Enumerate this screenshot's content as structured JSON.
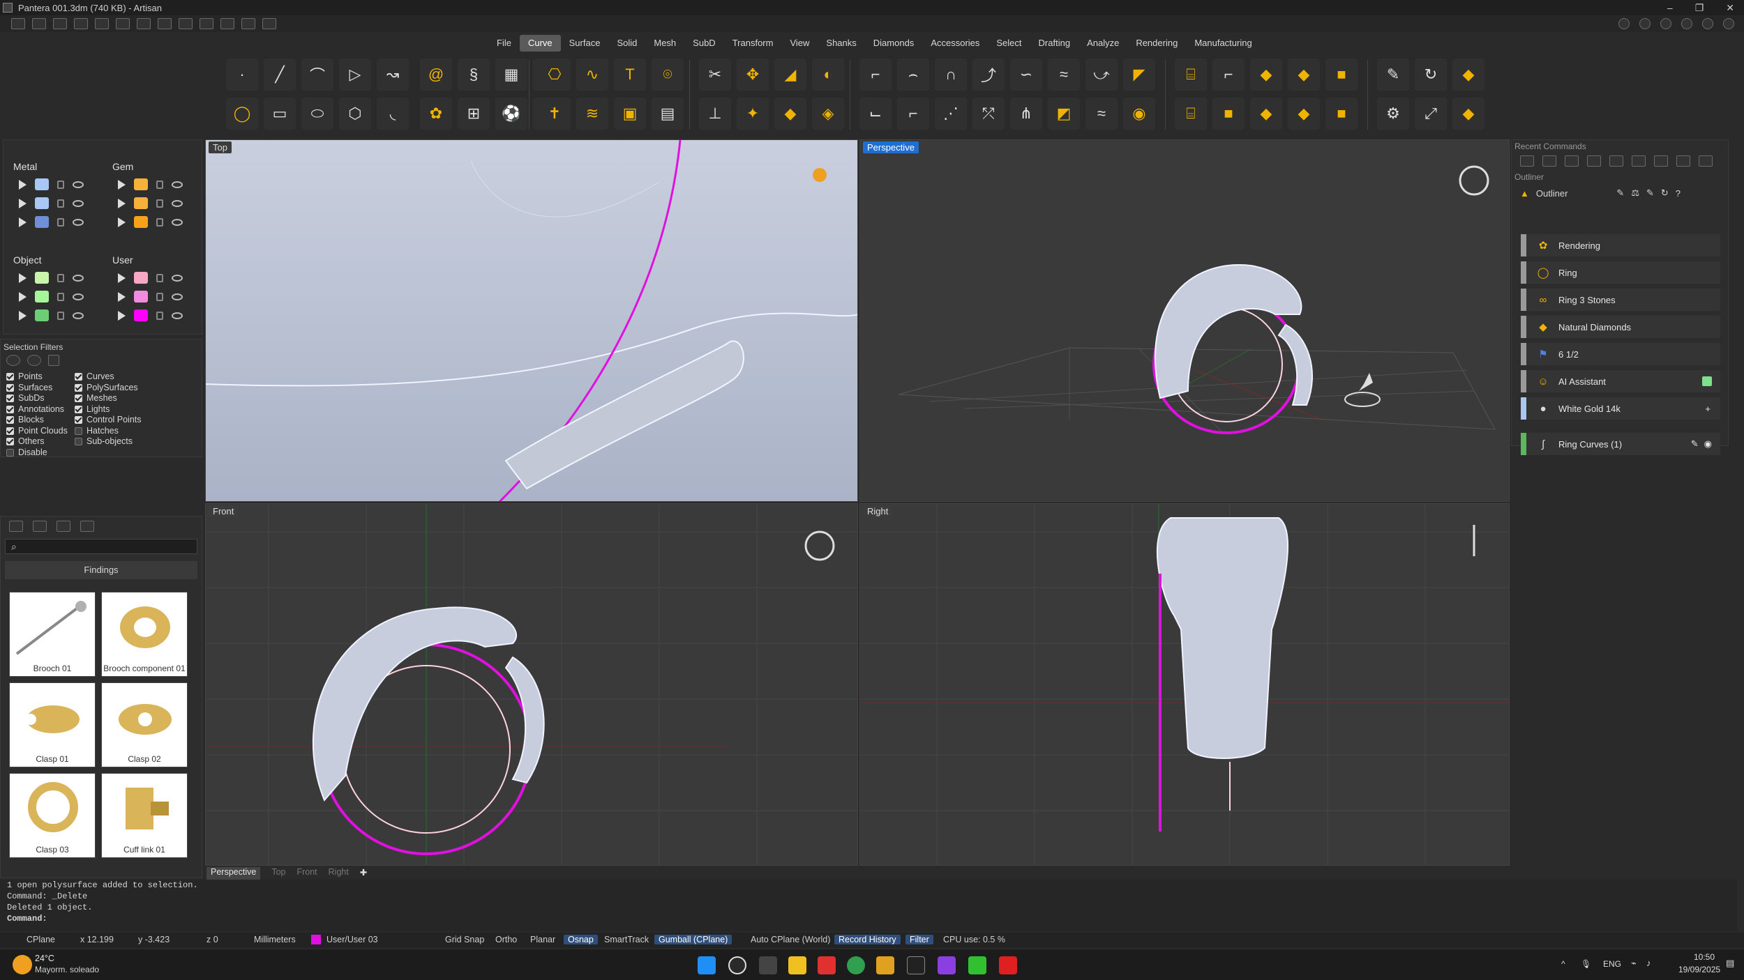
{
  "window": {
    "title": "Pantera 001.3dm (740 KB) - Artisan",
    "buttons": [
      "–",
      "❐",
      "✕"
    ]
  },
  "menu_tabs": [
    "File",
    "Curve",
    "Surface",
    "Solid",
    "Mesh",
    "SubD",
    "Transform",
    "View",
    "Shanks",
    "Diamonds",
    "Accessories",
    "Select",
    "Drafting",
    "Analyze",
    "Rendering",
    "Manufacturing"
  ],
  "active_menu_tab": "Curve",
  "layers": {
    "metal": {
      "title": "Metal",
      "colors": [
        "#a9c7f5",
        "#a9c7f5",
        "#6f8fd8"
      ]
    },
    "gem": {
      "title": "Gem",
      "colors": [
        "#f6b13b",
        "#f6b13b",
        "#f6a21b"
      ]
    },
    "object": {
      "title": "Object",
      "colors": [
        "#c8f5a9",
        "#a6f59a",
        "#6ccf74"
      ]
    },
    "user": {
      "title": "User",
      "colors": [
        "#f7a7c4",
        "#f08be0",
        "#ff00ff"
      ]
    }
  },
  "selection_filters": {
    "title": "Selection Filters",
    "col1": [
      {
        "label": "Points",
        "checked": true
      },
      {
        "label": "Surfaces",
        "checked": true
      },
      {
        "label": "SubDs",
        "checked": true
      },
      {
        "label": "Annotations",
        "checked": true
      },
      {
        "label": "Blocks",
        "checked": true
      },
      {
        "label": "Point Clouds",
        "checked": true
      },
      {
        "label": "Others",
        "checked": true
      },
      {
        "label": "Disable",
        "checked": false
      }
    ],
    "col2": [
      {
        "label": "Curves",
        "checked": true
      },
      {
        "label": "PolySurfaces",
        "checked": true
      },
      {
        "label": "Meshes",
        "checked": true
      },
      {
        "label": "Lights",
        "checked": true
      },
      {
        "label": "Control Points",
        "checked": true
      },
      {
        "label": "Hatches",
        "checked": false
      },
      {
        "label": "Sub-objects",
        "checked": false
      }
    ]
  },
  "findings": {
    "section_title": "Findings",
    "items": [
      "Brooch 01",
      "Brooch component 01",
      "Clasp 01",
      "Clasp 02",
      "Clasp 03",
      "Cuff link 01"
    ]
  },
  "viewports": {
    "top": "Top",
    "perspective": "Perspective",
    "front": "Front",
    "right": "Right"
  },
  "viewport_tabs": [
    "Perspective",
    "Top",
    "Front",
    "Right"
  ],
  "right_panel": {
    "recent_commands": "Recent Commands",
    "outliner_section": "Outliner",
    "outliner_title": "Outliner",
    "items": [
      {
        "label": "Rendering",
        "icon": "palette-icon"
      },
      {
        "label": "Ring",
        "icon": "ring-icon"
      },
      {
        "label": "Ring 3 Stones",
        "icon": "stones-icon"
      },
      {
        "label": "Natural Diamonds",
        "icon": "diamond-icon"
      },
      {
        "label": "6 1/2",
        "icon": "flag-icon"
      },
      {
        "label": "AI Assistant",
        "icon": "ai-icon"
      },
      {
        "label": "White Gold 14k",
        "icon": "metal-icon"
      },
      {
        "label": "Ring Curves (1)",
        "icon": "curve-icon"
      }
    ]
  },
  "console": {
    "lines": [
      "1 open polysurface added to selection.",
      "Command: _Delete",
      "Deleted 1 object."
    ],
    "prompt": "Command:"
  },
  "statusbar": {
    "cplane": "CPlane",
    "x": "x 12.199",
    "y": "y -3.423",
    "z": "z 0",
    "units": "Millimeters",
    "layer": "User/User 03",
    "grid_snap": "Grid Snap",
    "ortho": "Ortho",
    "planar": "Planar",
    "osnap": "Osnap",
    "smarttrack": "SmartTrack",
    "gumball": "Gumball (CPlane)",
    "auto_cplane": "Auto CPlane (World)",
    "record_history": "Record History",
    "filter": "Filter",
    "cpu": "CPU use: 0.5 %"
  },
  "taskbar": {
    "weather_temp": "24°C",
    "weather_text": "Mayorm. soleado",
    "lang": "ENG",
    "time": "10:50",
    "date": "19/09/2025"
  }
}
